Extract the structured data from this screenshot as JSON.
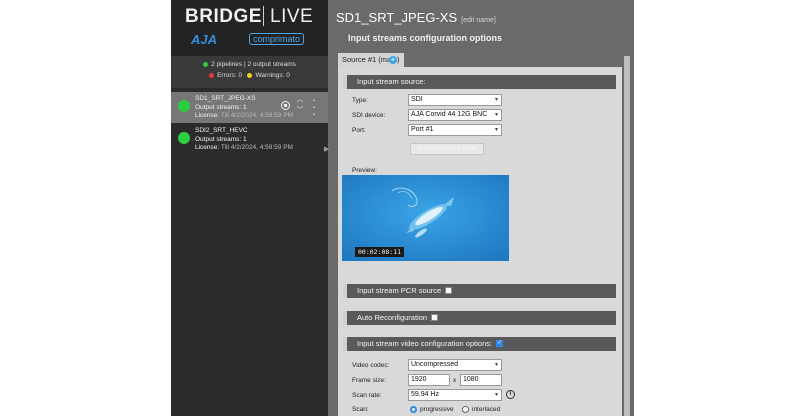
{
  "brand": {
    "main": "BRIDGE",
    "live": "LIVE",
    "aja": "AJA",
    "comprimato": "comprimato"
  },
  "summary": {
    "pipelines": "2 pipelines | 2 output streams",
    "errors_label": "Errors:",
    "errors_count": "0",
    "warnings_label": "Warnings:",
    "warnings_count": "0"
  },
  "pipelines": [
    {
      "name": "SD1_SRT_JPEG-XS",
      "output": "Output streams: 1",
      "license_label": "License:",
      "license_date": "Till 4/2/2024, 4:59:59 PM",
      "active": true
    },
    {
      "name": "SDI2_SRT_HEVC",
      "output": "Output streams: 1",
      "license_label": "License:",
      "license_date": "Till 4/2/2024, 4:59:59 PM",
      "active": false
    }
  ],
  "main": {
    "title": "SD1_SRT_JPEG-XS",
    "edit_name": "[edit name]",
    "subtitle": "Input streams configuration options",
    "tab_label": "Source #1 (main)",
    "tab_add": "+"
  },
  "input_source": {
    "header": "Input stream source:",
    "type_label": "Type:",
    "type_value": "SDI",
    "device_label": "SDI device:",
    "device_value": "AJA Corvid 44 12G BNC",
    "port_label": "Port:",
    "port_value": "Port #1",
    "detect_button": "Start Detecting Input",
    "preview_label": "Preview:",
    "timecode": "00:02:08:11"
  },
  "pcr": {
    "header": "Input stream PCR source",
    "checked": false
  },
  "auto_reconfig": {
    "header": "Auto Reconfiguration",
    "checked": false
  },
  "video_config": {
    "header": "Input stream video configuration options:",
    "checked": true,
    "codec_label": "Video codec:",
    "codec_value": "Uncompressed",
    "frame_label": "Frame size:",
    "frame_width": "1920",
    "frame_x": "x",
    "frame_height": "1080",
    "scanrate_label": "Scan rate:",
    "scanrate_value": "59.94 Hz",
    "info_icon": "i",
    "scan_label": "Scan:",
    "scan_progressive": "progressive",
    "scan_interlaced": "interlaced"
  },
  "colors": {
    "sidebar_bg": "#2b2b2b",
    "active_item": "#777777",
    "main_bg": "#6a6a6a",
    "panel_bg": "#d9d9d9",
    "accent_blue": "#2f86e6",
    "status_green": "#2ecc40",
    "error_red": "#e23b3b",
    "warning_yellow": "#f1d21c"
  },
  "icons": {
    "stop": "stop-circle-icon",
    "reorder": "chevron-up-down-icon",
    "more": "kebab-menu-icon",
    "add": "plus-icon",
    "info": "info-icon"
  }
}
